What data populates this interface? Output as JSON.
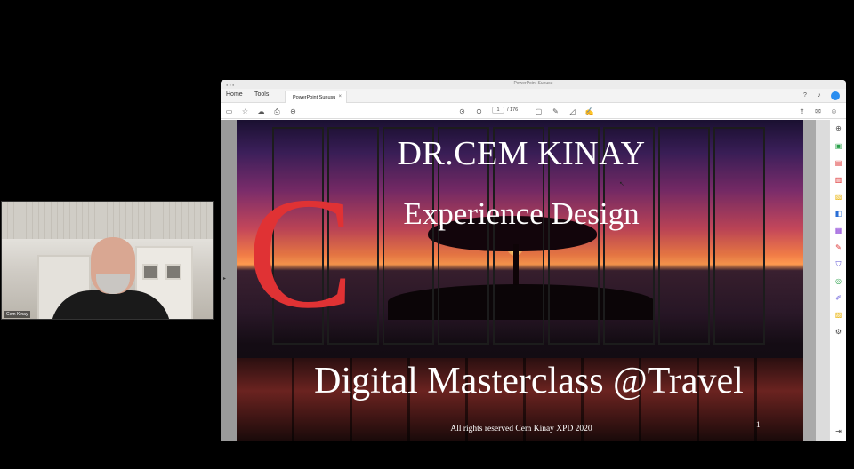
{
  "participant": {
    "name": "Cem Kinay"
  },
  "window": {
    "title": "PowerPoint Sunusu",
    "nav_tabs": [
      "Home",
      "Tools"
    ],
    "doc_tab": {
      "label": "PowerPoint Sunusu",
      "close": "×"
    },
    "page": {
      "current": "1",
      "total": "/ 176"
    }
  },
  "slide": {
    "logo_letter": "C",
    "title": "DR.CEM KINAY",
    "subtitle": "Experience Design",
    "headline": "Digital Masterclass @Travel",
    "footer": "All rights reserved Cem Kinay XPD 2020",
    "page_number": "1"
  },
  "icons": {
    "toolbar_left": [
      "save-icon",
      "bookmark-star-icon",
      "cloud-upload-icon",
      "print-icon",
      "zoom-icon"
    ],
    "toolbar_center": [
      "page-up-icon",
      "page-down-icon",
      "comment-icon",
      "pen-icon",
      "highlight-icon",
      "sign-icon"
    ],
    "toolbar_right": [
      "share-icon",
      "email-icon",
      "add-user-icon"
    ],
    "right_panel": [
      "zoom-panel-icon",
      "export-pdf-icon",
      "organize-pages-icon",
      "create-pdf-icon",
      "comment-panel-icon",
      "combine-files-icon",
      "edit-pdf-icon",
      "fill-sign-icon",
      "protect-icon",
      "optimize-icon",
      "redact-icon",
      "request-signature-icon",
      "more-tools-icon"
    ]
  },
  "colors": {
    "accent_red": "#e03234",
    "acrobat_blue": "#2a8ef0"
  }
}
